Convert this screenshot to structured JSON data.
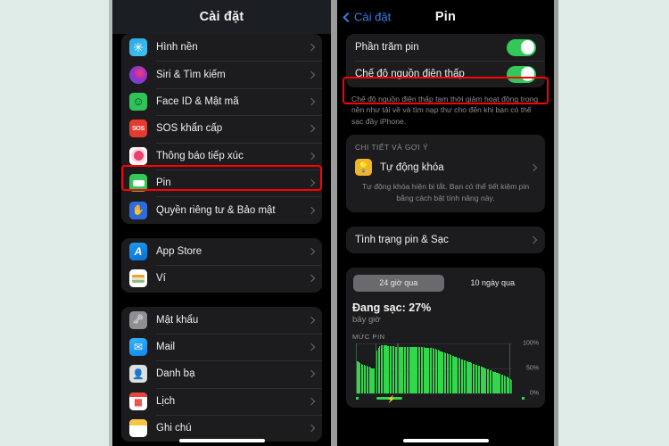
{
  "background_color": "#dfebe7",
  "left_phone": {
    "nav": {
      "title": "Cài đặt"
    },
    "groups": [
      {
        "items": [
          {
            "label": "Hình nền",
            "icon": "wallpaper-icon"
          },
          {
            "label": "Siri & Tìm kiếm",
            "icon": "siri-icon"
          },
          {
            "label": "Face ID & Mật mã",
            "icon": "faceid-icon"
          },
          {
            "label": "SOS khẩn cấp",
            "icon": "sos-icon"
          },
          {
            "label": "Thông báo tiếp xúc",
            "icon": "exposure-notification-icon"
          },
          {
            "label": "Pin",
            "icon": "battery-icon",
            "highlighted": true
          },
          {
            "label": "Quyền riêng tư & Bảo mật",
            "icon": "privacy-hand-icon"
          }
        ]
      },
      {
        "items": [
          {
            "label": "App Store",
            "icon": "app-store-icon"
          },
          {
            "label": "Ví",
            "icon": "wallet-icon"
          }
        ]
      },
      {
        "items": [
          {
            "label": "Mật khẩu",
            "icon": "passwords-key-icon"
          },
          {
            "label": "Mail",
            "icon": "mail-icon"
          },
          {
            "label": "Danh bạ",
            "icon": "contacts-icon"
          },
          {
            "label": "Lịch",
            "icon": "calendar-icon"
          },
          {
            "label": "Ghi chú",
            "icon": "notes-icon"
          }
        ]
      }
    ]
  },
  "right_phone": {
    "nav": {
      "back_label": "Cài đặt",
      "title": "Pin"
    },
    "toggles": [
      {
        "label": "Phần trăm pin",
        "on": true,
        "highlighted": false
      },
      {
        "label": "Chế độ nguồn điện thấp",
        "on": true,
        "highlighted": true
      }
    ],
    "footnote": "Chế độ nguồn điện thấp tạm thời giảm hoạt động trong nền như tải về và tìm nạp thư cho đến khi bạn có thể sạc đầy iPhone.",
    "details_section": {
      "header": "CHI TIẾT VÀ GỢI Ý",
      "item_title": "Tự động khóa",
      "item_body": "Tự động khóa hiện bị tắt. Bạn có thể tiết kiệm pin bằng cách bật tính năng này."
    },
    "battery_health_link": "Tình trạng pin & Sạc",
    "segmented": {
      "options": [
        "24 giờ qua",
        "10 ngày qua"
      ],
      "selected": "24 giờ qua"
    },
    "charge_status": {
      "title": "Đang sạc: 27%",
      "subtitle": "bây giờ"
    },
    "chart_title": "MỨC PIN"
  },
  "chart_data": {
    "type": "bar",
    "title": "MỨC PIN",
    "xlabel": "",
    "ylabel": "",
    "ylim": [
      0,
      100
    ],
    "ytick_labels": [
      "100%",
      "50%",
      "0%"
    ],
    "ytick_values": [
      100,
      50,
      0
    ],
    "grid": true,
    "legend": null,
    "series": [
      {
        "name": "Mức pin",
        "color": "#32d74b",
        "values": [
          62,
          65,
          63,
          61,
          59,
          58,
          57,
          56,
          55,
          54,
          53,
          52,
          51,
          50,
          50,
          28,
          86,
          92,
          95,
          96,
          96,
          96,
          96,
          96,
          95,
          95,
          95,
          95,
          95,
          95,
          94,
          94,
          94,
          94,
          94,
          94,
          94,
          94,
          94,
          94,
          94,
          94,
          94,
          94,
          94,
          94,
          93,
          93,
          93,
          93,
          93,
          93,
          93,
          92,
          92,
          92,
          92,
          91,
          91,
          91,
          90,
          89,
          88,
          87,
          86,
          85,
          84,
          83,
          82,
          81,
          80,
          79,
          78,
          77,
          76,
          75,
          74,
          73,
          72,
          71,
          70,
          69,
          68,
          67,
          66,
          65,
          64,
          63,
          62,
          61,
          60,
          59,
          58,
          57,
          56,
          55,
          54,
          53,
          52,
          51,
          50,
          49,
          48,
          47,
          46,
          45,
          44,
          43,
          42,
          41,
          40,
          39,
          38,
          37,
          36,
          35,
          34,
          33,
          31,
          29,
          27
        ],
        "last_bar_color": "#e8452c"
      }
    ],
    "charging_periods": [
      {
        "start_index": 0,
        "end_index": 1,
        "label": "charging-dot"
      },
      {
        "start_index": 15,
        "end_index": 32,
        "label": "charging-bolt"
      },
      {
        "start_index": 119,
        "end_index": 120,
        "label": "charging-dot"
      }
    ]
  }
}
